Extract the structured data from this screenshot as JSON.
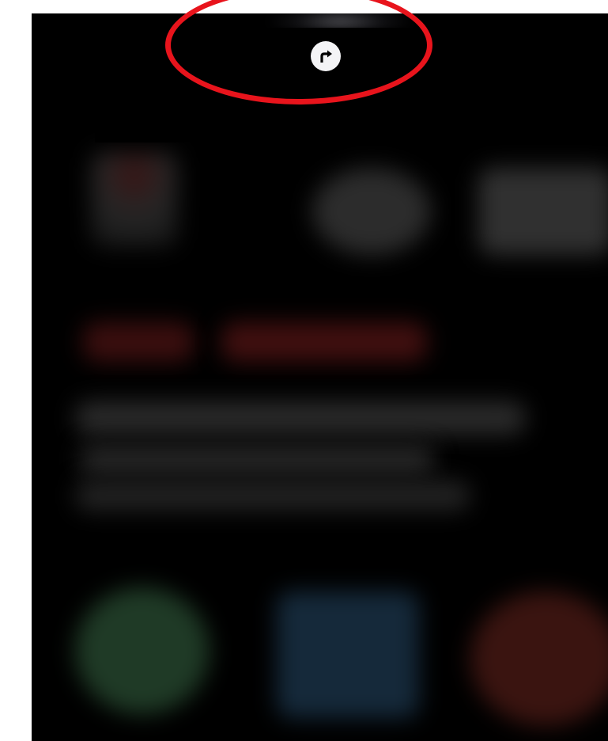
{
  "header": {
    "directions_button": {
      "icon": "turn-right-arrow-icon",
      "color_bg": "#f4f4f6",
      "color_fg": "#000000"
    }
  },
  "annotation": {
    "shape": "ellipse",
    "color": "#e8141c",
    "target": "directions-button"
  },
  "background": {
    "blurred": true,
    "color": "#000000"
  }
}
